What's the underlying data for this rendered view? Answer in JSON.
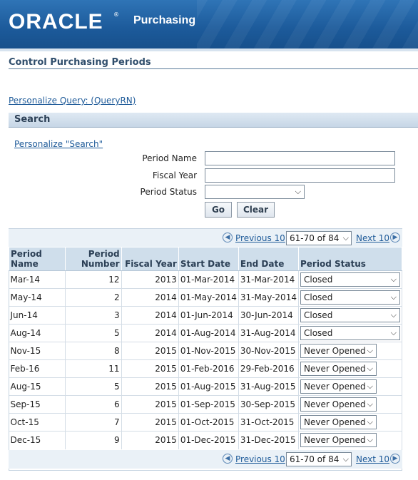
{
  "header": {
    "logo_text": "ORACLE",
    "logo_mark": "®",
    "app_name": "Purchasing"
  },
  "page": {
    "title": "Control Purchasing Periods"
  },
  "links": {
    "personalize_query": "Personalize Query: (QueryRN)",
    "personalize_search": "Personalize \"Search\""
  },
  "search": {
    "header": "Search",
    "period_name_label": "Period Name",
    "period_name_value": "",
    "fiscal_year_label": "Fiscal Year",
    "fiscal_year_value": "",
    "period_status_label": "Period Status",
    "period_status_value": "",
    "go_label": "Go",
    "clear_label": "Clear"
  },
  "pagination": {
    "previous_label": "Previous 10",
    "range_value": "61-70 of 84",
    "next_label": "Next 10"
  },
  "table": {
    "headers": {
      "period_name": "Period\nName",
      "period_number": "Period\nNumber",
      "fiscal_year": "Fiscal Year",
      "start_date": "Start Date",
      "end_date": "End Date",
      "period_status": "Period Status"
    },
    "rows": [
      {
        "period_name": "Mar-14",
        "period_number": "12",
        "fiscal_year": "2013",
        "start_date": "01-Mar-2014",
        "end_date": "31-Mar-2014",
        "status": "Closed"
      },
      {
        "period_name": "May-14",
        "period_number": "2",
        "fiscal_year": "2014",
        "start_date": "01-May-2014",
        "end_date": "31-May-2014",
        "status": "Closed"
      },
      {
        "period_name": "Jun-14",
        "period_number": "3",
        "fiscal_year": "2014",
        "start_date": "01-Jun-2014",
        "end_date": "30-Jun-2014",
        "status": "Closed"
      },
      {
        "period_name": "Aug-14",
        "period_number": "5",
        "fiscal_year": "2014",
        "start_date": "01-Aug-2014",
        "end_date": "31-Aug-2014",
        "status": "Closed"
      },
      {
        "period_name": "Nov-15",
        "period_number": "8",
        "fiscal_year": "2015",
        "start_date": "01-Nov-2015",
        "end_date": "30-Nov-2015",
        "status": "Never Opened"
      },
      {
        "period_name": "Feb-16",
        "period_number": "11",
        "fiscal_year": "2015",
        "start_date": "01-Feb-2016",
        "end_date": "29-Feb-2016",
        "status": "Never Opened"
      },
      {
        "period_name": "Aug-15",
        "period_number": "5",
        "fiscal_year": "2015",
        "start_date": "01-Aug-2015",
        "end_date": "31-Aug-2015",
        "status": "Never Opened"
      },
      {
        "period_name": "Sep-15",
        "period_number": "6",
        "fiscal_year": "2015",
        "start_date": "01-Sep-2015",
        "end_date": "30-Sep-2015",
        "status": "Never Opened"
      },
      {
        "period_name": "Oct-15",
        "period_number": "7",
        "fiscal_year": "2015",
        "start_date": "01-Oct-2015",
        "end_date": "31-Oct-2015",
        "status": "Never Opened"
      },
      {
        "period_name": "Dec-15",
        "period_number": "9",
        "fiscal_year": "2015",
        "start_date": "01-Dec-2015",
        "end_date": "31-Dec-2015",
        "status": "Never Opened"
      }
    ]
  },
  "icons": {
    "previous": "previous-arrow-icon",
    "next": "next-arrow-icon",
    "dropdown": "chevron-down-icon"
  }
}
